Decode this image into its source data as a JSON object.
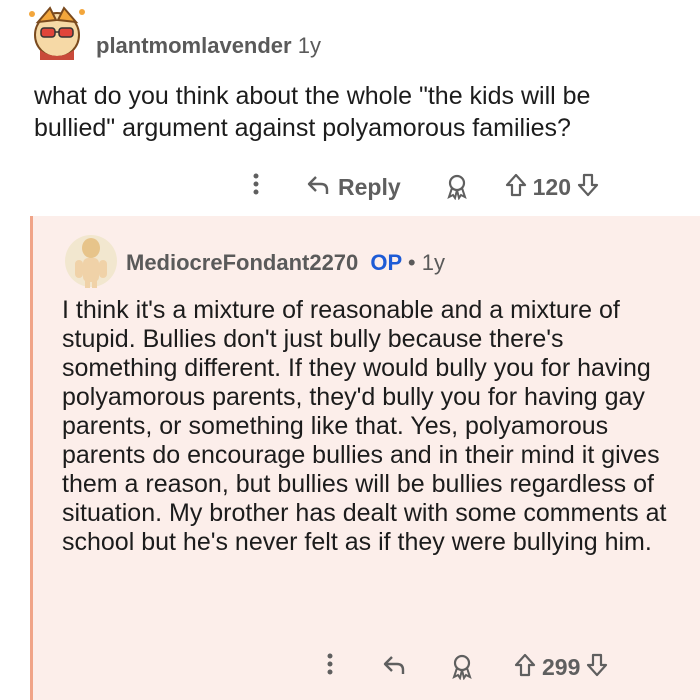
{
  "comment": {
    "username": "plantmomlavender",
    "age": "1y",
    "body": "what do you think about the whole \"the kids will be bullied\" argument against polyamorous families?",
    "actions": {
      "more_icon": "more-vertical-icon",
      "reply_icon": "reply-arrow-icon",
      "reply_label": "Reply",
      "award_icon": "award-icon",
      "upvote_icon": "upvote-arrow-icon",
      "score": "120",
      "downvote_icon": "downvote-arrow-icon"
    }
  },
  "reply": {
    "username": "MediocreFondant2270",
    "op_badge": "OP",
    "separator": "•",
    "age": "1y",
    "body": "I think it's a mixture of reasonable and a mixture of stupid. Bullies don't just bully because there's something different. If they would bully you for having polyamorous parents, they'd bully you for having gay parents, or something like that. Yes, polyamorous parents do encourage bullies and in their mind it gives them a reason, but bullies will be bullies regardless of situation. My brother has dealt with some comments at school but he's never felt as if they were bullying him.",
    "actions": {
      "more_icon": "more-vertical-icon",
      "reply_icon": "reply-arrow-icon",
      "award_icon": "award-icon",
      "upvote_icon": "upvote-arrow-icon",
      "score": "299",
      "downvote_icon": "downvote-arrow-icon"
    }
  },
  "colors": {
    "thread_line": "#f0a488",
    "reply_background": "#fceeea",
    "op_badge": "#1d5bd6",
    "meta_text": "#5a5a5a"
  }
}
